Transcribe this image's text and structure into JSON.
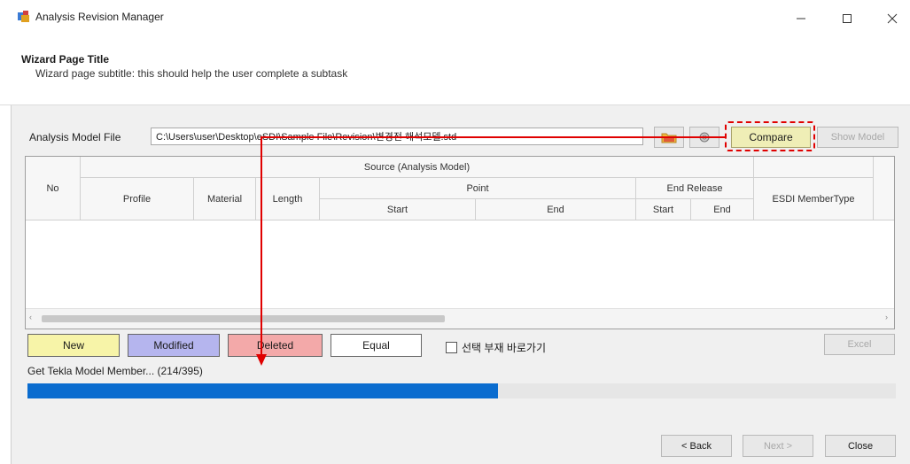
{
  "window": {
    "title": "Analysis Revision Manager"
  },
  "wizard": {
    "title": "Wizard Page Title",
    "subtitle": "Wizard page subtitle: this should help the user complete a subtask"
  },
  "file_row": {
    "label": "Analysis Model File",
    "path": "C:\\Users\\user\\Desktop\\eSDI\\Sample File\\Revision\\변경전 해석모델.std",
    "compare_label": "Compare",
    "show_model_label": "Show Model"
  },
  "table": {
    "col_no": "No",
    "group_source": "Source (Analysis Model)",
    "col_profile": "Profile",
    "col_material": "Material",
    "col_length": "Length",
    "group_point": "Point",
    "col_point_start": "Start",
    "col_point_end": "End",
    "group_release": "End Release",
    "col_release_start": "Start",
    "col_release_end": "End",
    "col_esdi": "ESDI MemberType",
    "rows": []
  },
  "legend": {
    "new": "New",
    "modified": "Modified",
    "deleted": "Deleted",
    "equal": "Equal",
    "new_color": "#f7f4a8",
    "modified_color": "#b5b5ee",
    "deleted_color": "#f3a9a9"
  },
  "shortcut_checkbox": {
    "label": "선택 부재 바로가기",
    "checked": false
  },
  "excel_label": "Excel",
  "status": {
    "text": "Get Tekla Model Member... (214/395)",
    "progress_fraction": 0.5418
  },
  "footer": {
    "back": "< Back",
    "next": "Next >",
    "close": "Close"
  },
  "highlight_color": "#e00000"
}
